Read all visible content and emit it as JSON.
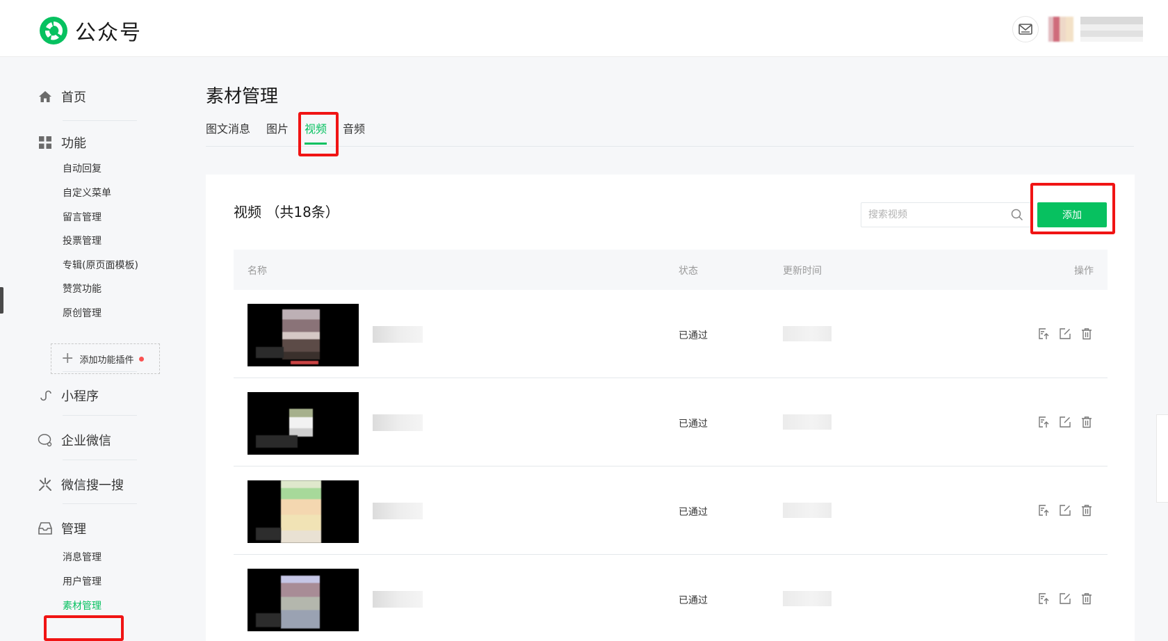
{
  "header": {
    "brand": "公众号"
  },
  "sidebar": {
    "home": "首页",
    "features": "功能",
    "feature_items": [
      "自动回复",
      "自定义菜单",
      "留言管理",
      "投票管理",
      "专辑(原页面模板)",
      "赞赏功能",
      "原创管理"
    ],
    "add_plugin": "添加功能插件",
    "miniprogram": "小程序",
    "wecom": "企业微信",
    "search": "微信搜一搜",
    "manage": "管理",
    "manage_items": [
      "消息管理",
      "用户管理",
      "素材管理"
    ]
  },
  "main": {
    "title": "素材管理",
    "tabs": [
      "图文消息",
      "图片",
      "视频",
      "音频"
    ],
    "active_tab": "视频",
    "card_title": "视频 （共18条）",
    "search_placeholder": "搜索视频",
    "add_button": "添加",
    "columns": [
      "名称",
      "状态",
      "更新时间",
      "操作"
    ],
    "rows": [
      {
        "status": "已通过"
      },
      {
        "status": "已通过"
      },
      {
        "status": "已通过"
      },
      {
        "status": "已通过"
      }
    ]
  },
  "colors": {
    "accent": "#07c160",
    "annotation": "#f01414"
  },
  "icons": [
    "mail-icon",
    "home-icon",
    "grid-icon",
    "plus-icon",
    "link-icon",
    "wecom-icon",
    "sou-icon",
    "inbox-icon",
    "search-icon",
    "upload-icon",
    "edit-icon",
    "delete-icon"
  ]
}
